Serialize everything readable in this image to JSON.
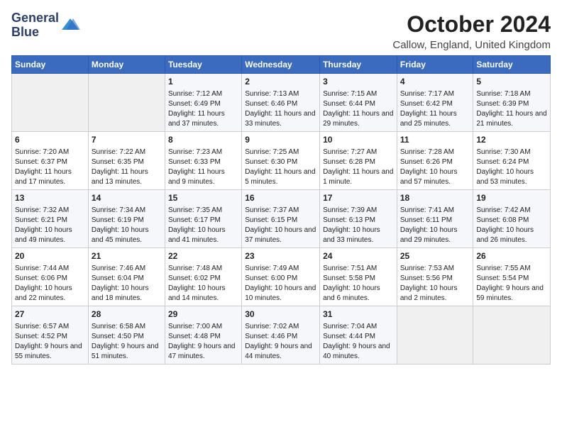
{
  "logo": {
    "line1": "General",
    "line2": "Blue"
  },
  "title": "October 2024",
  "location": "Callow, England, United Kingdom",
  "weekdays": [
    "Sunday",
    "Monday",
    "Tuesday",
    "Wednesday",
    "Thursday",
    "Friday",
    "Saturday"
  ],
  "weeks": [
    [
      {
        "day": "",
        "content": ""
      },
      {
        "day": "",
        "content": ""
      },
      {
        "day": "1",
        "content": "Sunrise: 7:12 AM\nSunset: 6:49 PM\nDaylight: 11 hours and 37 minutes."
      },
      {
        "day": "2",
        "content": "Sunrise: 7:13 AM\nSunset: 6:46 PM\nDaylight: 11 hours and 33 minutes."
      },
      {
        "day": "3",
        "content": "Sunrise: 7:15 AM\nSunset: 6:44 PM\nDaylight: 11 hours and 29 minutes."
      },
      {
        "day": "4",
        "content": "Sunrise: 7:17 AM\nSunset: 6:42 PM\nDaylight: 11 hours and 25 minutes."
      },
      {
        "day": "5",
        "content": "Sunrise: 7:18 AM\nSunset: 6:39 PM\nDaylight: 11 hours and 21 minutes."
      }
    ],
    [
      {
        "day": "6",
        "content": "Sunrise: 7:20 AM\nSunset: 6:37 PM\nDaylight: 11 hours and 17 minutes."
      },
      {
        "day": "7",
        "content": "Sunrise: 7:22 AM\nSunset: 6:35 PM\nDaylight: 11 hours and 13 minutes."
      },
      {
        "day": "8",
        "content": "Sunrise: 7:23 AM\nSunset: 6:33 PM\nDaylight: 11 hours and 9 minutes."
      },
      {
        "day": "9",
        "content": "Sunrise: 7:25 AM\nSunset: 6:30 PM\nDaylight: 11 hours and 5 minutes."
      },
      {
        "day": "10",
        "content": "Sunrise: 7:27 AM\nSunset: 6:28 PM\nDaylight: 11 hours and 1 minute."
      },
      {
        "day": "11",
        "content": "Sunrise: 7:28 AM\nSunset: 6:26 PM\nDaylight: 10 hours and 57 minutes."
      },
      {
        "day": "12",
        "content": "Sunrise: 7:30 AM\nSunset: 6:24 PM\nDaylight: 10 hours and 53 minutes."
      }
    ],
    [
      {
        "day": "13",
        "content": "Sunrise: 7:32 AM\nSunset: 6:21 PM\nDaylight: 10 hours and 49 minutes."
      },
      {
        "day": "14",
        "content": "Sunrise: 7:34 AM\nSunset: 6:19 PM\nDaylight: 10 hours and 45 minutes."
      },
      {
        "day": "15",
        "content": "Sunrise: 7:35 AM\nSunset: 6:17 PM\nDaylight: 10 hours and 41 minutes."
      },
      {
        "day": "16",
        "content": "Sunrise: 7:37 AM\nSunset: 6:15 PM\nDaylight: 10 hours and 37 minutes."
      },
      {
        "day": "17",
        "content": "Sunrise: 7:39 AM\nSunset: 6:13 PM\nDaylight: 10 hours and 33 minutes."
      },
      {
        "day": "18",
        "content": "Sunrise: 7:41 AM\nSunset: 6:11 PM\nDaylight: 10 hours and 29 minutes."
      },
      {
        "day": "19",
        "content": "Sunrise: 7:42 AM\nSunset: 6:08 PM\nDaylight: 10 hours and 26 minutes."
      }
    ],
    [
      {
        "day": "20",
        "content": "Sunrise: 7:44 AM\nSunset: 6:06 PM\nDaylight: 10 hours and 22 minutes."
      },
      {
        "day": "21",
        "content": "Sunrise: 7:46 AM\nSunset: 6:04 PM\nDaylight: 10 hours and 18 minutes."
      },
      {
        "day": "22",
        "content": "Sunrise: 7:48 AM\nSunset: 6:02 PM\nDaylight: 10 hours and 14 minutes."
      },
      {
        "day": "23",
        "content": "Sunrise: 7:49 AM\nSunset: 6:00 PM\nDaylight: 10 hours and 10 minutes."
      },
      {
        "day": "24",
        "content": "Sunrise: 7:51 AM\nSunset: 5:58 PM\nDaylight: 10 hours and 6 minutes."
      },
      {
        "day": "25",
        "content": "Sunrise: 7:53 AM\nSunset: 5:56 PM\nDaylight: 10 hours and 2 minutes."
      },
      {
        "day": "26",
        "content": "Sunrise: 7:55 AM\nSunset: 5:54 PM\nDaylight: 9 hours and 59 minutes."
      }
    ],
    [
      {
        "day": "27",
        "content": "Sunrise: 6:57 AM\nSunset: 4:52 PM\nDaylight: 9 hours and 55 minutes."
      },
      {
        "day": "28",
        "content": "Sunrise: 6:58 AM\nSunset: 4:50 PM\nDaylight: 9 hours and 51 minutes."
      },
      {
        "day": "29",
        "content": "Sunrise: 7:00 AM\nSunset: 4:48 PM\nDaylight: 9 hours and 47 minutes."
      },
      {
        "day": "30",
        "content": "Sunrise: 7:02 AM\nSunset: 4:46 PM\nDaylight: 9 hours and 44 minutes."
      },
      {
        "day": "31",
        "content": "Sunrise: 7:04 AM\nSunset: 4:44 PM\nDaylight: 9 hours and 40 minutes."
      },
      {
        "day": "",
        "content": ""
      },
      {
        "day": "",
        "content": ""
      }
    ]
  ]
}
